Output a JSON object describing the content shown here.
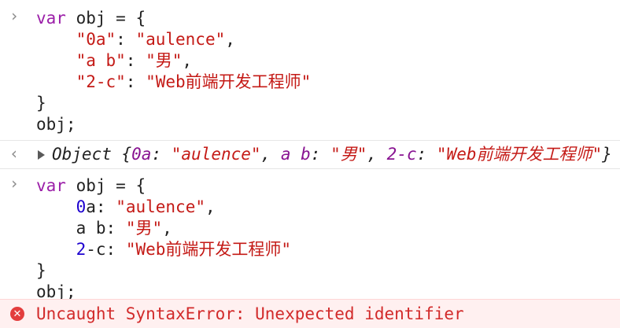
{
  "console": {
    "prompt_glyph": "›",
    "return_glyph": "‹",
    "input1": {
      "l1_kw": "var",
      "l1_rest": " obj = {",
      "l2_key": "\"0a\"",
      "l2_sep": ": ",
      "l2_val": "\"aulence\"",
      "l2_end": ",",
      "l3_key": "\"a b\"",
      "l3_sep": ": ",
      "l3_val": "\"男\"",
      "l3_end": ",",
      "l4_key": "\"2-c\"",
      "l4_sep": ": ",
      "l4_val": "\"Web前端开发工程师\"",
      "l5": "}",
      "l6": "obj;"
    },
    "result": {
      "type": "Object",
      "open": " {",
      "k1": "0a",
      "s1": ": ",
      "v1": "\"aulence\"",
      "c1": ", ",
      "k2": "a b",
      "s2": ": ",
      "v2": "\"男\"",
      "c2": ", ",
      "k3": "2-c",
      "s3": ": ",
      "v3": "\"Web前端开发工程师\"",
      "close": "}"
    },
    "input2": {
      "l1_kw": "var",
      "l1_rest": " obj = {",
      "l2_num": "0",
      "l2_id": "a",
      "l2_sep": ": ",
      "l2_val": "\"aulence\"",
      "l2_end": ",",
      "l3_id": "a b",
      "l3_sep": ": ",
      "l3_val": "\"男\"",
      "l3_end": ",",
      "l4_num": "2",
      "l4_id": "-c",
      "l4_sep": ": ",
      "l4_val": "\"Web前端开发工程师\"",
      "l5": "}",
      "l6": "obj;"
    },
    "error": {
      "icon_text": "✕",
      "message": "Uncaught SyntaxError: Unexpected identifier"
    }
  },
  "colors": {
    "keyword": "#9b1ea8",
    "string": "#c41a16",
    "number": "#1c00cf",
    "error": "#d22a2a",
    "error_bg": "#fff0f0"
  }
}
